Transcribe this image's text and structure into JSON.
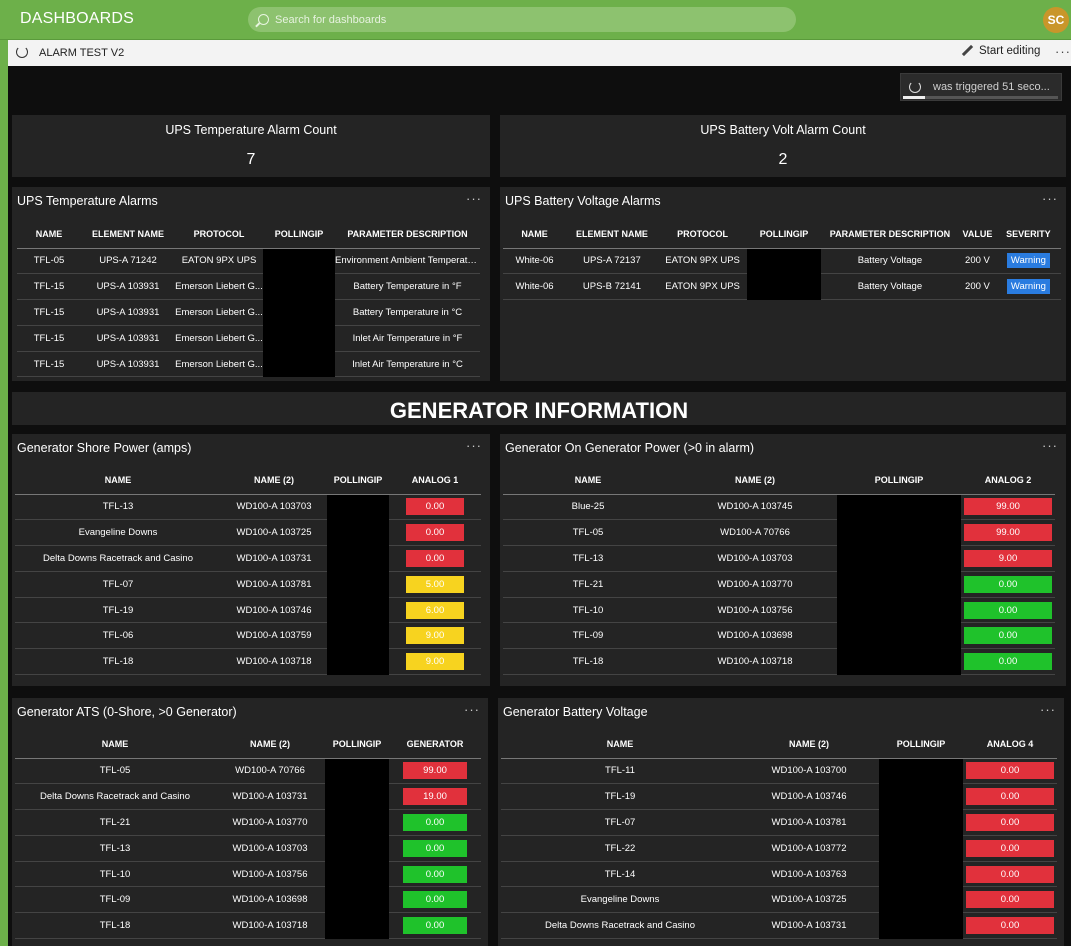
{
  "topbar": {
    "brand": "DASHBOARDS",
    "search_placeholder": "Search for dashboards",
    "avatar": "SC"
  },
  "subbar": {
    "title": "ALARM TEST V2",
    "edit": "Start editing",
    "more": "···"
  },
  "trigger": {
    "text": "was triggered 51 seco...",
    "progress": 0.14
  },
  "stats": [
    {
      "title": "UPS Temperature Alarm Count",
      "value": "7"
    },
    {
      "title": "UPS Battery Volt Alarm Count",
      "value": "2"
    }
  ],
  "ups_temp": {
    "title": "UPS Temperature Alarms",
    "columns": [
      "NAME",
      "ELEMENT NAME",
      "PROTOCOL",
      "POLLINGIP",
      "PARAMETER DESCRIPTION"
    ],
    "rows": [
      [
        "TFL-05",
        "UPS-A 71242",
        "EATON 9PX UPS",
        "",
        "Environment Ambient Temperatu..."
      ],
      [
        "TFL-15",
        "UPS-A 103931",
        "Emerson Liebert G...",
        "",
        "Battery Temperature in °F"
      ],
      [
        "TFL-15",
        "UPS-A 103931",
        "Emerson Liebert G...",
        "",
        "Battery Temperature in °C"
      ],
      [
        "TFL-15",
        "UPS-A 103931",
        "Emerson Liebert G...",
        "",
        "Inlet Air Temperature in °F"
      ],
      [
        "TFL-15",
        "UPS-A 103931",
        "Emerson Liebert G...",
        "",
        "Inlet Air Temperature in °C"
      ]
    ]
  },
  "ups_batt": {
    "title": "UPS Battery Voltage Alarms",
    "columns": [
      "NAME",
      "ELEMENT NAME",
      "PROTOCOL",
      "POLLINGIP",
      "PARAMETER DESCRIPTION",
      "VALUE",
      "SEVERITY"
    ],
    "rows": [
      [
        "White-06",
        "UPS-A 72137",
        "EATON 9PX UPS",
        "",
        "Battery Voltage",
        "200 V",
        "Warning"
      ],
      [
        "White-06",
        "UPS-B 72141",
        "EATON 9PX UPS",
        "",
        "Battery Voltage",
        "200 V",
        "Warning"
      ]
    ]
  },
  "section_header": "GENERATOR INFORMATION",
  "gen_shore": {
    "title": "Generator Shore Power (amps)",
    "columns": [
      "NAME",
      "NAME (2)",
      "POLLINGIP",
      "ANALOG 1"
    ],
    "rows": [
      [
        "TFL-13",
        "WD100-A 103703",
        "",
        "0.00",
        "red"
      ],
      [
        "Evangeline Downs",
        "WD100-A 103725",
        "",
        "0.00",
        "red"
      ],
      [
        "Delta Downs Racetrack and Casino",
        "WD100-A 103731",
        "",
        "0.00",
        "red"
      ],
      [
        "TFL-07",
        "WD100-A 103781",
        "",
        "5.00",
        "yel"
      ],
      [
        "TFL-19",
        "WD100-A 103746",
        "",
        "6.00",
        "yel"
      ],
      [
        "TFL-06",
        "WD100-A 103759",
        "",
        "9.00",
        "yel"
      ],
      [
        "TFL-18",
        "WD100-A 103718",
        "",
        "9.00",
        "yel"
      ]
    ]
  },
  "gen_on": {
    "title": "Generator On Generator Power (>0 in alarm)",
    "columns": [
      "NAME",
      "NAME (2)",
      "POLLINGIP",
      "ANALOG 2"
    ],
    "rows": [
      [
        "Blue-25",
        "WD100-A 103745",
        "",
        "99.00",
        "red"
      ],
      [
        "TFL-05",
        "WD100-A 70766",
        "",
        "99.00",
        "red"
      ],
      [
        "TFL-13",
        "WD100-A 103703",
        "",
        "9.00",
        "red"
      ],
      [
        "TFL-21",
        "WD100-A 103770",
        "",
        "0.00",
        "grn"
      ],
      [
        "TFL-10",
        "WD100-A 103756",
        "",
        "0.00",
        "grn"
      ],
      [
        "TFL-09",
        "WD100-A 103698",
        "",
        "0.00",
        "grn"
      ],
      [
        "TFL-18",
        "WD100-A 103718",
        "",
        "0.00",
        "grn"
      ]
    ]
  },
  "gen_ats": {
    "title": "Generator ATS (0-Shore, >0 Generator)",
    "columns": [
      "NAME",
      "NAME (2)",
      "POLLINGIP",
      "GENERATOR"
    ],
    "rows": [
      [
        "TFL-05",
        "WD100-A 70766",
        "",
        "99.00",
        "red"
      ],
      [
        "Delta Downs Racetrack and Casino",
        "WD100-A 103731",
        "",
        "19.00",
        "red"
      ],
      [
        "TFL-21",
        "WD100-A 103770",
        "",
        "0.00",
        "grn"
      ],
      [
        "TFL-13",
        "WD100-A 103703",
        "",
        "0.00",
        "grn"
      ],
      [
        "TFL-10",
        "WD100-A 103756",
        "",
        "0.00",
        "grn"
      ],
      [
        "TFL-09",
        "WD100-A 103698",
        "",
        "0.00",
        "grn"
      ],
      [
        "TFL-18",
        "WD100-A 103718",
        "",
        "0.00",
        "grn"
      ]
    ]
  },
  "gen_batt": {
    "title": "Generator Battery Voltage",
    "columns": [
      "NAME",
      "NAME (2)",
      "POLLINGIP",
      "ANALOG 4"
    ],
    "rows": [
      [
        "TFL-11",
        "WD100-A 103700",
        "",
        "0.00",
        "red"
      ],
      [
        "TFL-19",
        "WD100-A 103746",
        "",
        "0.00",
        "red"
      ],
      [
        "TFL-07",
        "WD100-A 103781",
        "",
        "0.00",
        "red"
      ],
      [
        "TFL-22",
        "WD100-A 103772",
        "",
        "0.00",
        "red"
      ],
      [
        "TFL-14",
        "WD100-A 103763",
        "",
        "0.00",
        "red"
      ],
      [
        "Evangeline Downs",
        "WD100-A 103725",
        "",
        "0.00",
        "red"
      ],
      [
        "Delta Downs Racetrack and Casino",
        "WD100-A 103731",
        "",
        "0.00",
        "red"
      ]
    ]
  },
  "colors": {
    "topbar": "#6db04a",
    "red": "#e1313c",
    "yellow": "#f7d31f",
    "green": "#1fc22b",
    "warning": "#2a7ce0"
  }
}
